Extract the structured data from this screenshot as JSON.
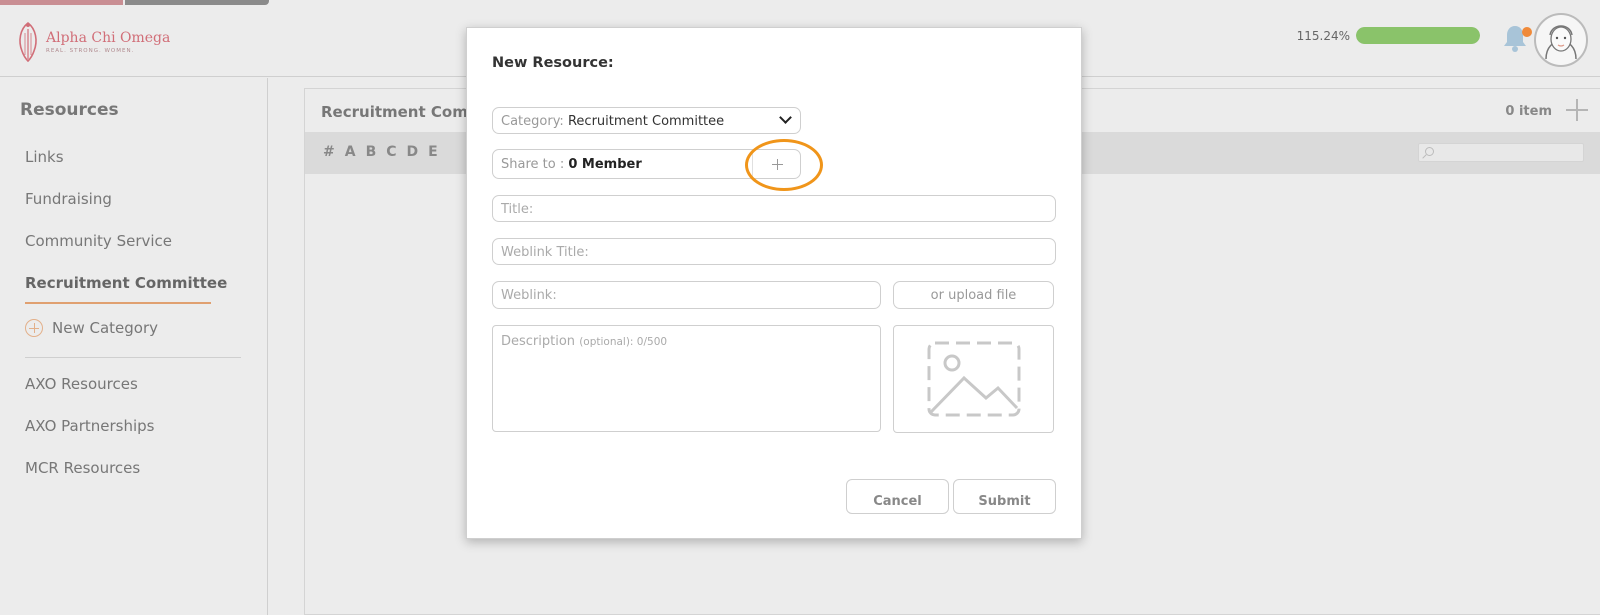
{
  "brand": {
    "name": "Alpha Chi Omega",
    "tagline": "REAL. STRONG. WOMEN.",
    "color": "#d16e78"
  },
  "header": {
    "progress_text": "115.24%",
    "progress_fraction": 1.0,
    "progress_color": "#8ac36a",
    "notification_icon": "bell-icon",
    "notification_dot_color": "#f08a3a",
    "avatar_icon": "user-avatar"
  },
  "sidebar": {
    "title": "Resources",
    "items": [
      {
        "label": "Links"
      },
      {
        "label": "Fundraising"
      },
      {
        "label": "Community Service"
      },
      {
        "label": "Recruitment Committee",
        "active": true
      }
    ],
    "new_category_label": "New Category",
    "secondary_items": [
      {
        "label": "AXO Resources"
      },
      {
        "label": "AXO Partnerships"
      },
      {
        "label": "MCR Resources"
      }
    ]
  },
  "main": {
    "title": "Recruitment Commi",
    "count": "0 item",
    "alphabet": [
      "#",
      "A",
      "B",
      "C",
      "D",
      "E"
    ]
  },
  "modal": {
    "title": "New Resource:",
    "category_label": "Category:",
    "category_value": "Recruitment Committee",
    "share_label": "Share to :",
    "share_value": "0 Member",
    "title_placeholder": "Title:",
    "weblink_title_placeholder": "Weblink Title:",
    "weblink_placeholder": "Weblink:",
    "upload_label": "or upload file",
    "description_label": "Description",
    "description_optional": "(optional): 0/500",
    "image_icon": "image-placeholder-icon",
    "cancel_label": "Cancel",
    "submit_label": "Submit",
    "highlight_color": "#f0951a"
  }
}
